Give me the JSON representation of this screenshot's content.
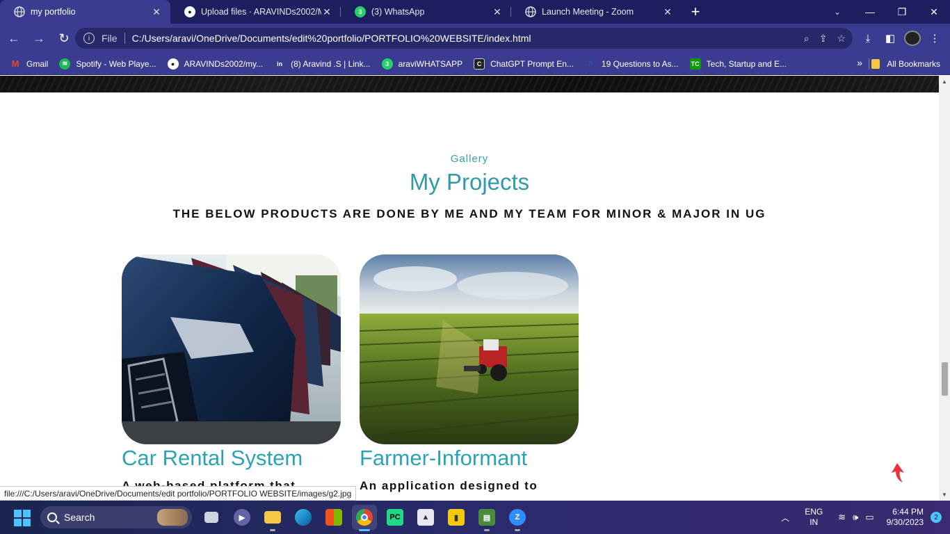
{
  "browser": {
    "tabs": [
      {
        "label": "my portfolio",
        "active": true,
        "icon": "globe-icon"
      },
      {
        "label": "Upload files · ARAVINDs2002/M",
        "active": false,
        "icon": "github-icon"
      },
      {
        "label": "(3) WhatsApp",
        "active": false,
        "icon": "whatsapp-icon"
      },
      {
        "label": "Launch Meeting - Zoom",
        "active": false,
        "icon": "globe-icon"
      }
    ],
    "omnibox": {
      "scheme_label": "File",
      "url": "C:/Users/aravi/OneDrive/Documents/edit%20portfolio/PORTFOLIO%20WEBSITE/index.html"
    },
    "bookmarks": [
      {
        "label": "Gmail",
        "icon": "gmail-icon",
        "color": "#ea4335"
      },
      {
        "label": "Spotify - Web Playe...",
        "icon": "spotify-icon",
        "color": "#1db954"
      },
      {
        "label": "ARAVINDs2002/my...",
        "icon": "github-icon",
        "color": "#ffffff"
      },
      {
        "label": "(8) Aravind .S | Link...",
        "icon": "linkedin-icon",
        "color": "#0a66c2"
      },
      {
        "label": "araviWHATSAPP",
        "icon": "whatsapp-icon",
        "color": "#25d366"
      },
      {
        "label": "ChatGPT Prompt En...",
        "icon": "chatgpt-icon",
        "color": "#222222"
      },
      {
        "label": "19 Questions to As...",
        "icon": "bookmark-page-icon",
        "color": "#1a5fc9"
      },
      {
        "label": "Tech, Startup and E...",
        "icon": "techcrunch-icon",
        "color": "#0a9e01"
      }
    ],
    "all_bookmarks_label": "All Bookmarks",
    "status_url": "file:///C:/Users/aravi/OneDrive/Documents/edit portfolio/PORTFOLIO WEBSITE/images/g2.jpg"
  },
  "page": {
    "kicker": "Gallery",
    "title": "My Projects",
    "subtitle": "THE BELOW PRODUCTS ARE DONE BY ME AND MY TEAM FOR MINOR & MAJOR IN UG",
    "projects": [
      {
        "title": "Car Rental System",
        "desc": "A web-based platform that",
        "image": "parked-cars-photo"
      },
      {
        "title": "Farmer-Informant",
        "desc": "An application designed to",
        "image": "tractor-field-photo"
      }
    ],
    "accent_color": "#2ba3b5"
  },
  "taskbar": {
    "search_label": "Search",
    "lang_line1": "ENG",
    "lang_line2": "IN",
    "time": "6:44 PM",
    "date": "9/30/2023",
    "notification_count": "2"
  }
}
